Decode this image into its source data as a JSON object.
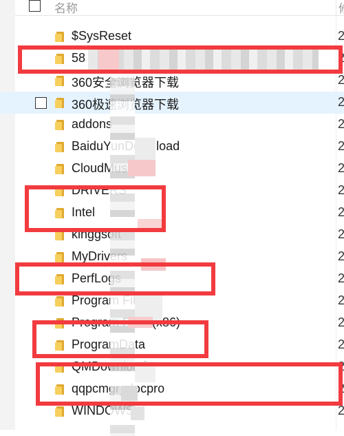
{
  "header": {
    "name": "名称",
    "col2": "修"
  },
  "rows": [
    {
      "label": "$SysReset",
      "date": "2"
    },
    {
      "label": "58",
      "date": "2"
    },
    {
      "label": "360安全浏览器下载",
      "date": "2"
    },
    {
      "label": "360极速浏览器下载",
      "date": "2"
    },
    {
      "label": "addons",
      "date": "2"
    },
    {
      "label": "BaiduYunDownload",
      "date": "2"
    },
    {
      "label": "CloudMusic",
      "date": "2"
    },
    {
      "label": "DRIVERS",
      "date": "2"
    },
    {
      "label": "Intel",
      "date": "2"
    },
    {
      "label": "kinggsoft",
      "date": "2"
    },
    {
      "label": "MyDrivers",
      "date": "2"
    },
    {
      "label": "PerfLogs",
      "date": "2"
    },
    {
      "label": "Program Files",
      "date": "2"
    },
    {
      "label": "Program Files (x86)",
      "date": "2"
    },
    {
      "label": "ProgramData",
      "date": "2"
    },
    {
      "label": "QMDownload",
      "date": "2"
    },
    {
      "label": "qqpcmgr_docpro",
      "date": "2"
    },
    {
      "label": "WINDOWS",
      "date": "2"
    }
  ]
}
